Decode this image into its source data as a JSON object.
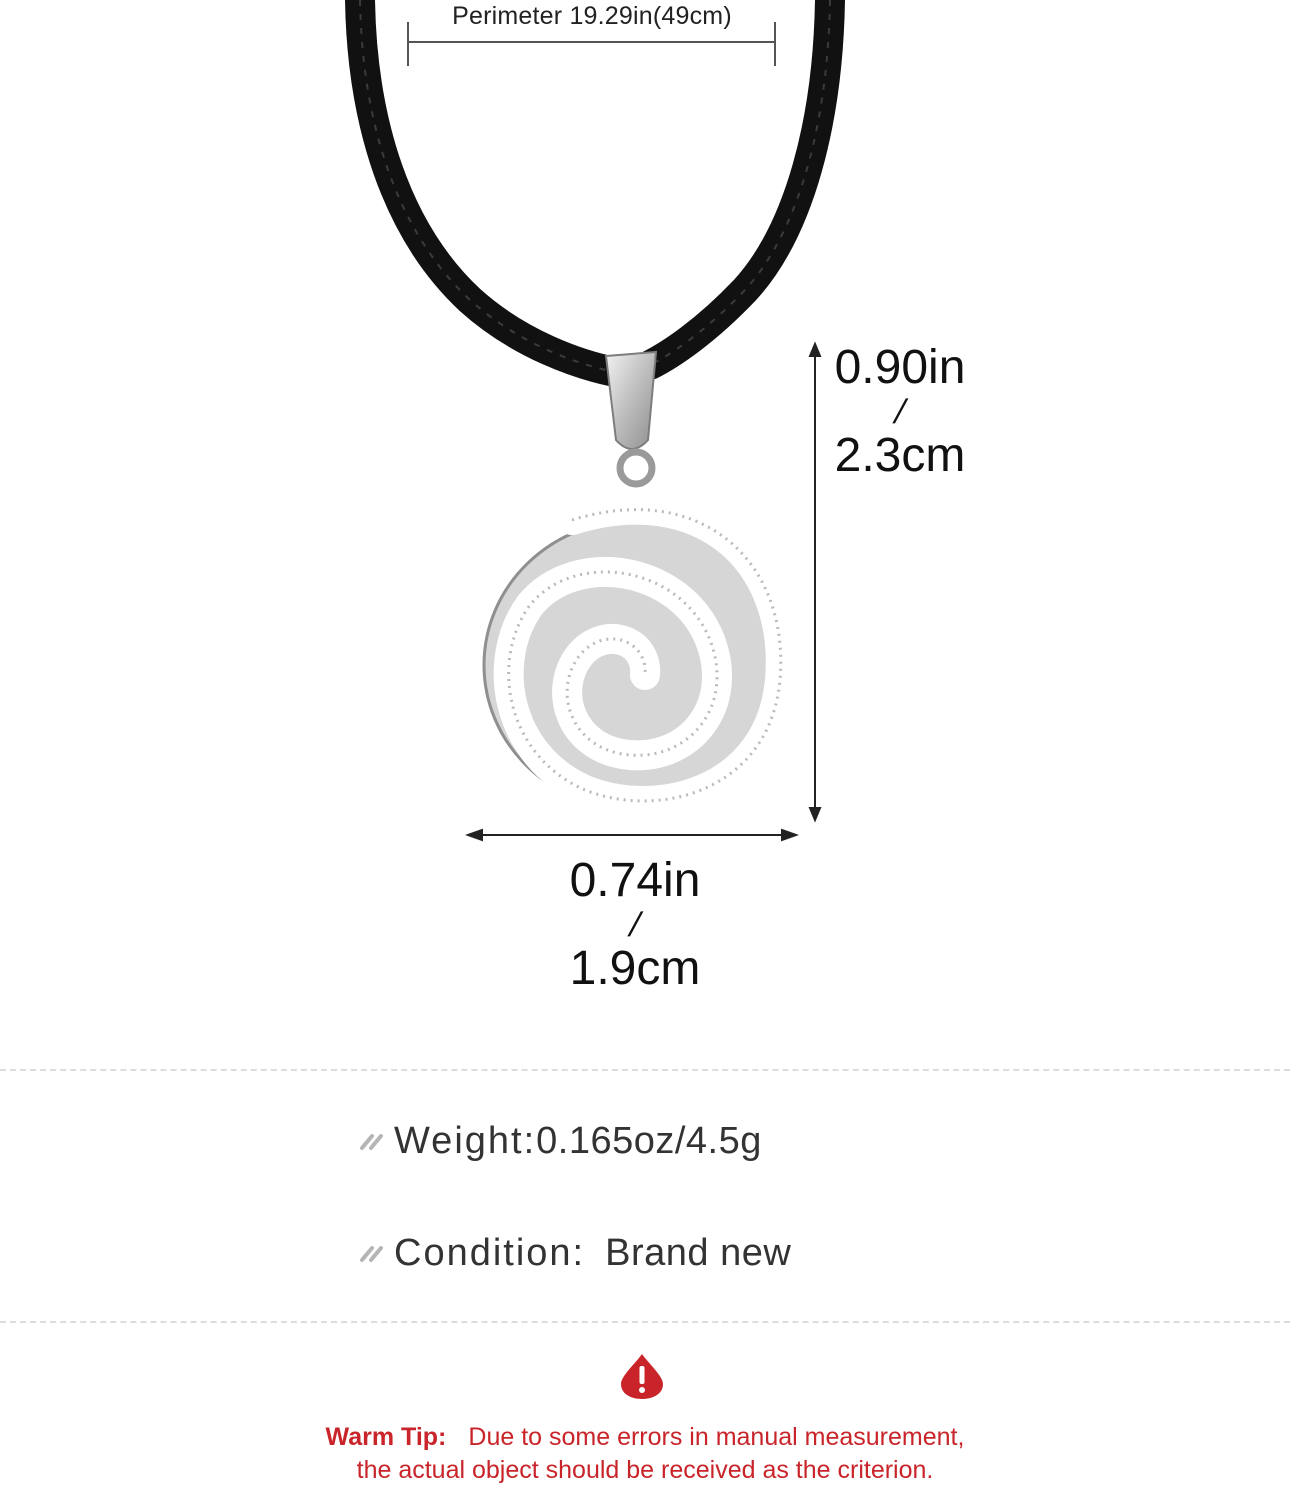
{
  "measurements": {
    "perimeter": "Perimeter 19.29in(49cm)",
    "height_in": "0.90in",
    "height_sep": "/",
    "height_cm": "2.3cm",
    "width_in": "0.74in",
    "width_sep": "/",
    "width_cm": "1.9cm"
  },
  "specs": {
    "weight_label": "Weight:",
    "weight_value": "0.165oz/4.5g",
    "condition_label": "Condition:",
    "condition_value": "Brand new"
  },
  "tip": {
    "label": "Warm Tip:",
    "line1": "Due to some errors in manual measurement,",
    "line2": "the actual object should be received as the criterion."
  },
  "colors": {
    "accent_red": "#c8242a",
    "cord": "#141414",
    "silver": "#c9c9c9"
  },
  "icons": {
    "spec_bullet": "double-slash-icon",
    "warning": "exclamation-drop-icon"
  }
}
